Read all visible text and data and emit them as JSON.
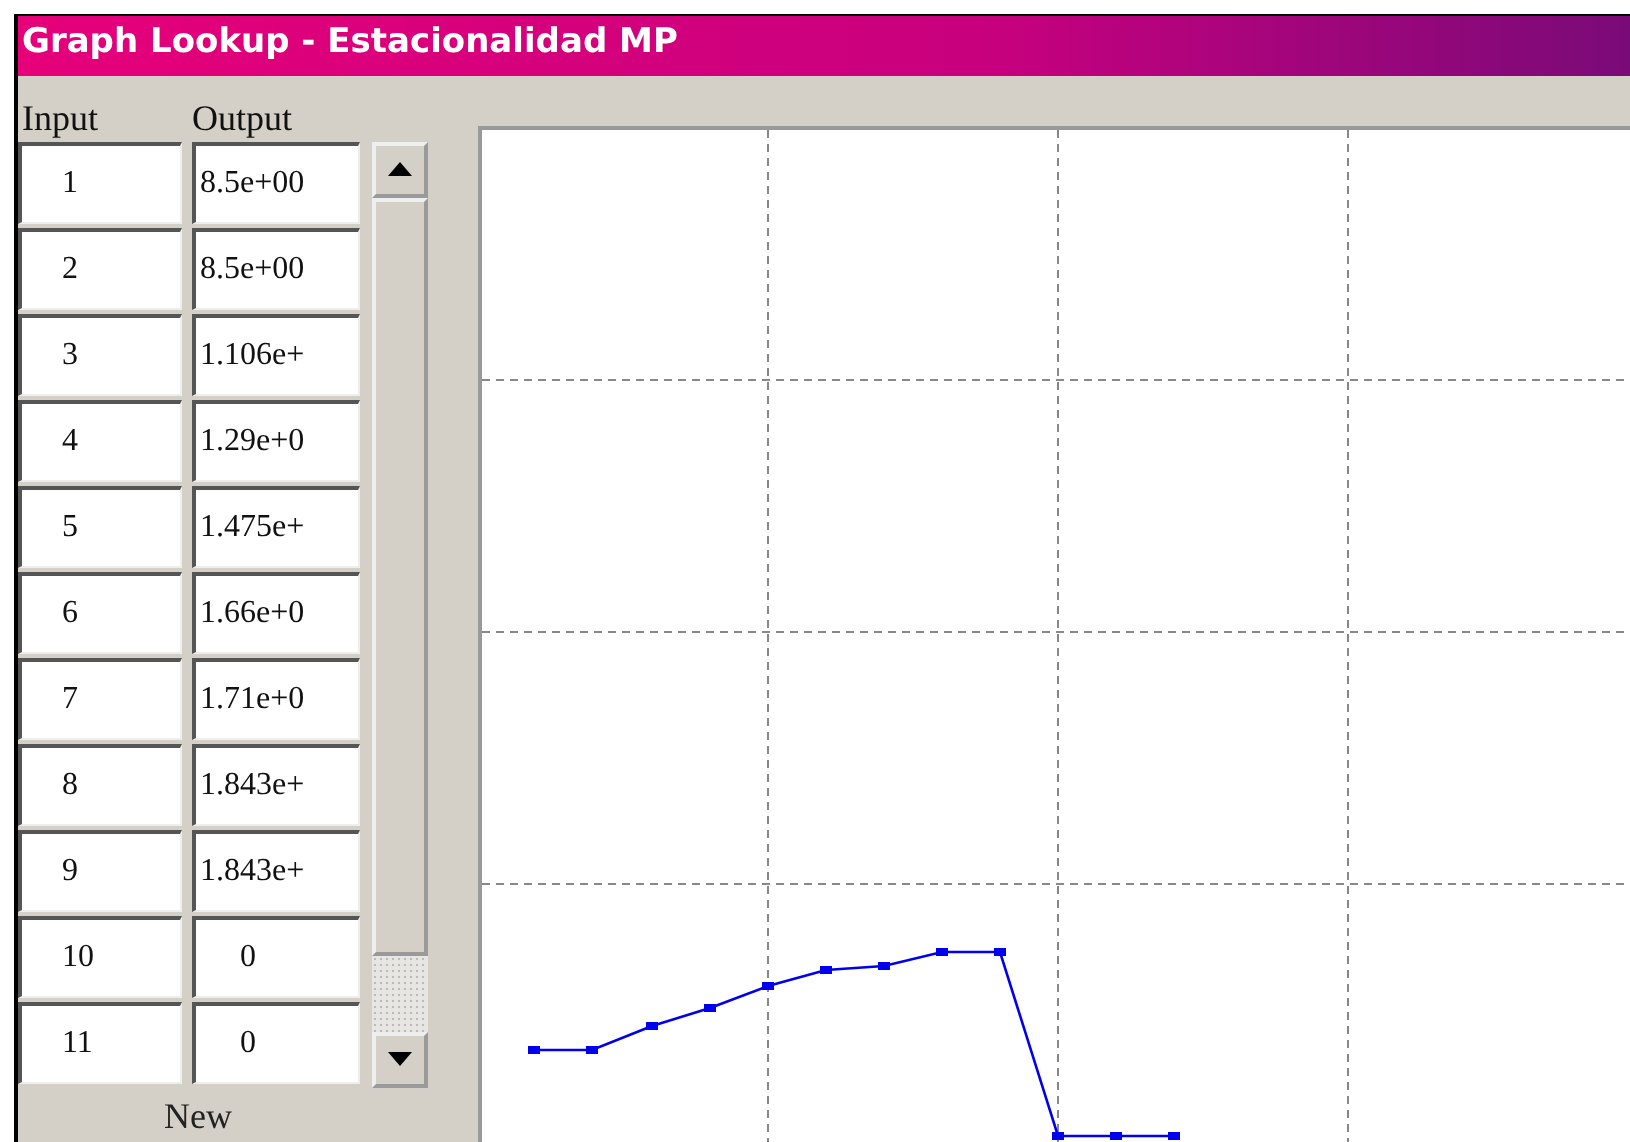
{
  "window": {
    "title": "Graph Lookup - Estacionalidad MP"
  },
  "table": {
    "columns": [
      "Input",
      "Output"
    ],
    "rows": [
      {
        "input": "1",
        "output": "8.5e+00"
      },
      {
        "input": "2",
        "output": "8.5e+00"
      },
      {
        "input": "3",
        "output": "1.106e+"
      },
      {
        "input": "4",
        "output": "1.29e+0"
      },
      {
        "input": "5",
        "output": "1.475e+"
      },
      {
        "input": "6",
        "output": "1.66e+0"
      },
      {
        "input": "7",
        "output": "1.71e+0"
      },
      {
        "input": "8",
        "output": "1.843e+"
      },
      {
        "input": "9",
        "output": "1.843e+"
      },
      {
        "input": "10",
        "output": "0"
      },
      {
        "input": "11",
        "output": "0"
      }
    ]
  },
  "new_button": "New"
}
